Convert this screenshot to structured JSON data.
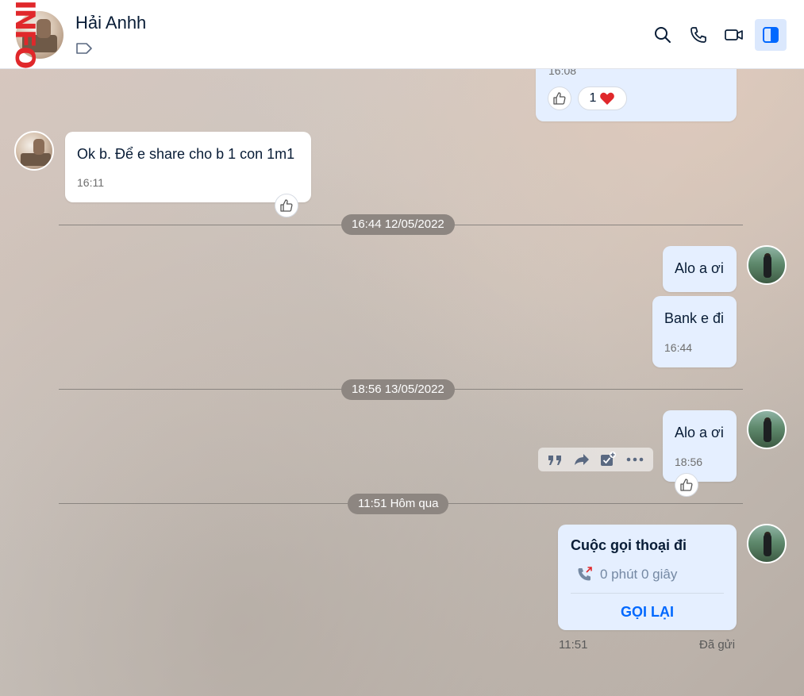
{
  "header": {
    "contact_name": "Hải Anhh",
    "overlay_text": "INFO"
  },
  "messages": {
    "top_partial": {
      "time": "16:08",
      "reaction_count": "1"
    },
    "m1": {
      "text": "Ok b. Để e share cho b 1 con 1m1",
      "time": "16:11"
    },
    "sep1": "16:44 12/05/2022",
    "m2": {
      "text": "Alo a ơi"
    },
    "m3": {
      "text": "Bank e đi",
      "time": "16:44"
    },
    "sep2": "18:56 13/05/2022",
    "m4": {
      "text": "Alo a ơi",
      "time": "18:56"
    },
    "sep3": "11:51 Hôm qua",
    "call": {
      "title": "Cuộc gọi thoại đi",
      "duration": "0 phút 0 giây",
      "action": "GỌI LẠI",
      "time": "11:51",
      "status": "Đã gửi"
    }
  },
  "colors": {
    "accent": "#0068ff",
    "bubble_me": "#e5efff",
    "bubble_other": "#ffffff",
    "missed_red": "#e0282b"
  }
}
